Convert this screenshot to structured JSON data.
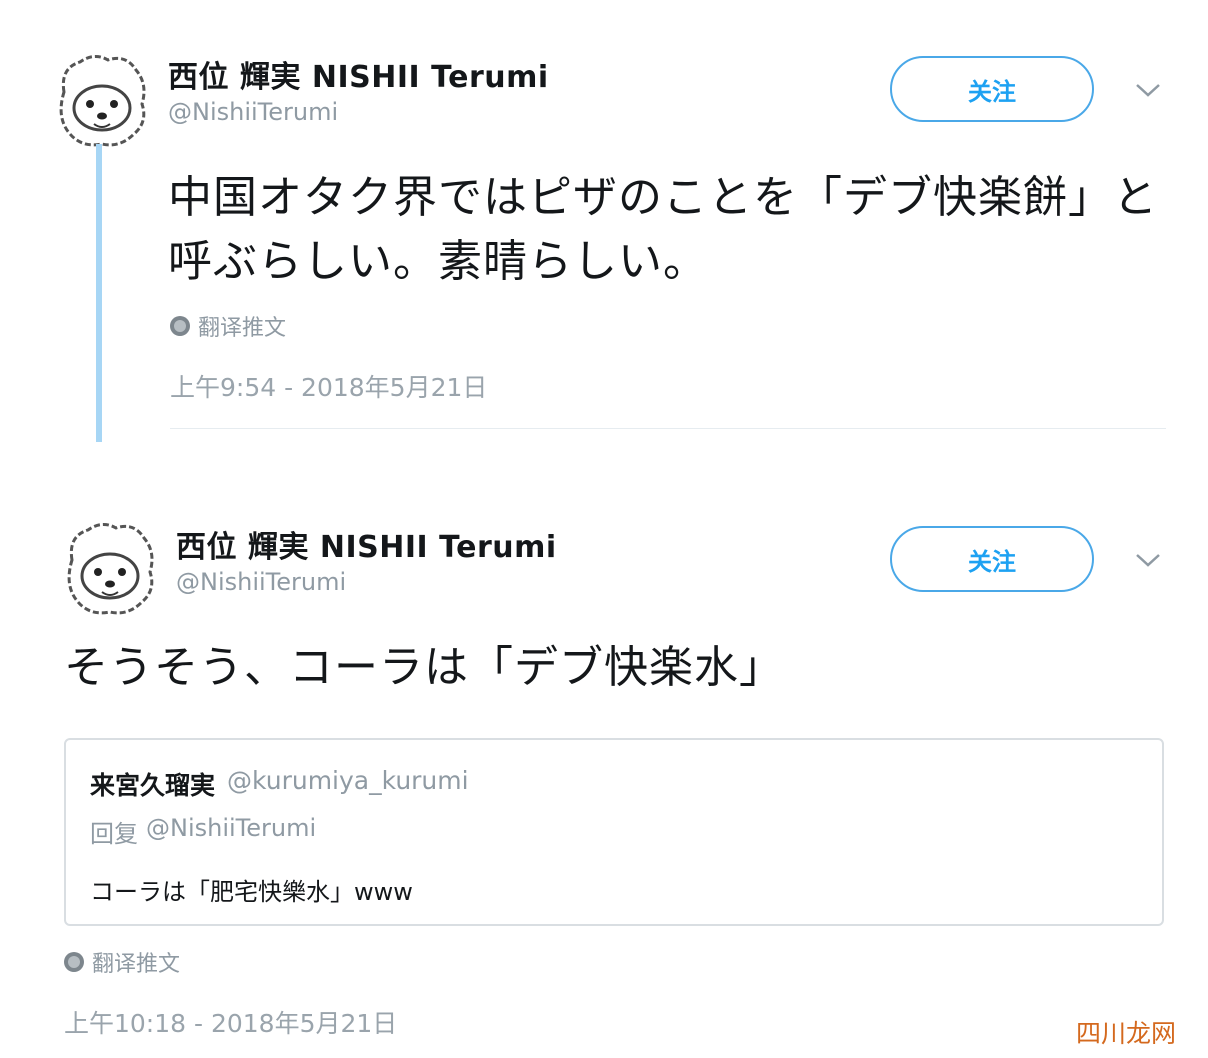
{
  "colors": {
    "accent": "#1da1f2",
    "thread_line": "#a7d6f5",
    "muted": "#8f9aa3",
    "border": "#d9dee2",
    "watermark": "#d4691e"
  },
  "tweets": [
    {
      "author": {
        "display_name": "西位 輝実 NISHII Terumi",
        "handle": "@NishiiTerumi",
        "avatar_icon": "bear-avatar-icon"
      },
      "follow_label": "关注",
      "text": "中国オタク界ではピザのことを「デブ快楽餅」と呼ぶらしい。素晴らしい。",
      "translate_label": "翻译推文",
      "timestamp": "上午9:54 - 2018年5月21日"
    },
    {
      "author": {
        "display_name": "西位 輝実 NISHII Terumi",
        "handle": "@NishiiTerumi",
        "avatar_icon": "bear-avatar-icon"
      },
      "follow_label": "关注",
      "text": "そうそう、コーラは「デブ快楽水」",
      "quoted": {
        "author_name": "来宮久瑠実",
        "author_handle": "@kurumiya_kurumi",
        "reply_prefix": "回复",
        "reply_handle": "@NishiiTerumi",
        "text": "コーラは「肥宅快樂水」www"
      },
      "translate_label": "翻译推文",
      "timestamp": "上午10:18 - 2018年5月21日"
    }
  ],
  "watermark": {
    "text": "四川龙网"
  }
}
